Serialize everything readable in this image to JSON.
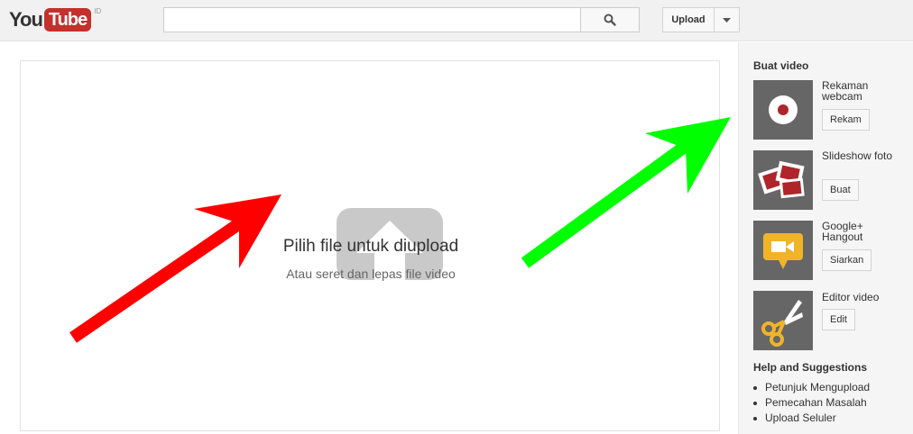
{
  "header": {
    "logo_you": "You",
    "logo_tube": "Tube",
    "logo_country": "ID",
    "search_placeholder": "",
    "upload_label": "Upload"
  },
  "main": {
    "drop_title": "Pilih file untuk diupload",
    "drop_subtitle": "Atau seret dan lepas file video"
  },
  "sidebar": {
    "create_heading": "Buat video",
    "tools": [
      {
        "label": "Rekaman webcam",
        "button": "Rekam",
        "icon": "webcam-record-icon"
      },
      {
        "label": "Slideshow foto",
        "button": "Buat",
        "icon": "photo-slideshow-icon"
      },
      {
        "label": "Google+ Hangout",
        "button": "Siarkan",
        "icon": "hangout-camera-icon"
      },
      {
        "label": "Editor video",
        "button": "Edit",
        "icon": "scissors-icon"
      }
    ],
    "help_heading": "Help and Suggestions",
    "help_links": [
      "Petunjuk Mengupload",
      "Pemecahan Masalah",
      "Upload Seluler"
    ]
  },
  "annotations": {
    "arrow_left_color": "#ff0000",
    "arrow_right_color": "#00ff00"
  },
  "colors": {
    "brand_red": "#c4302b",
    "sidebar_bg": "#f5f5f5",
    "thumb_bg": "#666666"
  }
}
